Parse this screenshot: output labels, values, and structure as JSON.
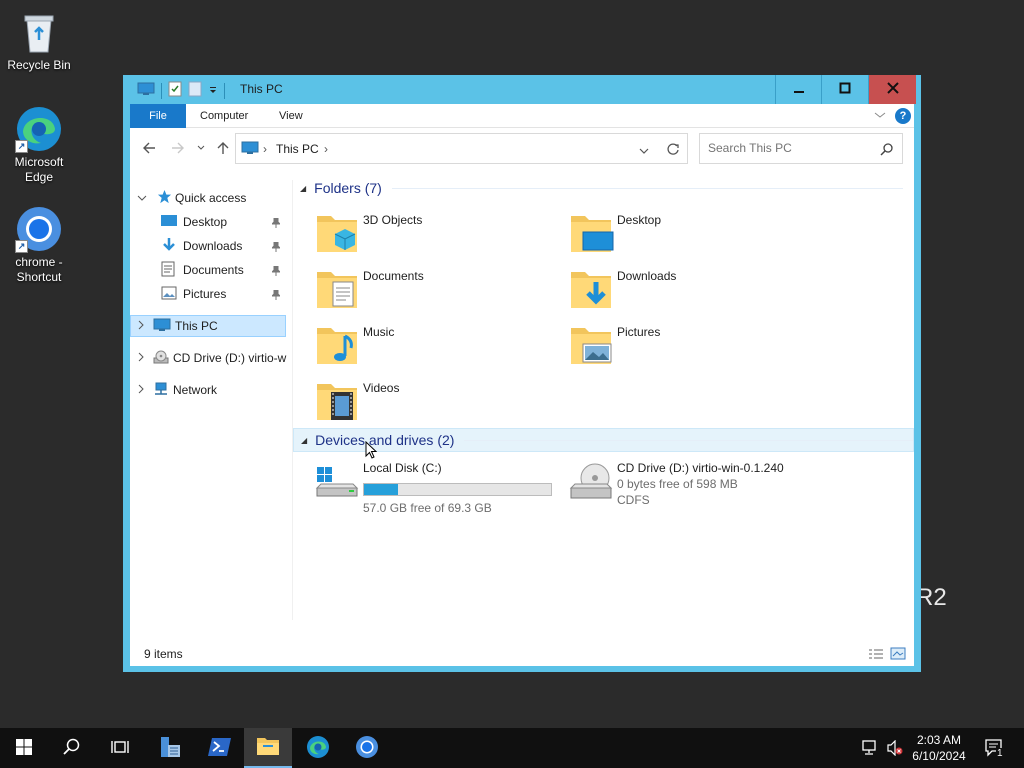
{
  "desktop": {
    "icons": [
      {
        "label": "Recycle Bin"
      },
      {
        "label": "Microsoft Edge"
      },
      {
        "label": "chrome - Shortcut"
      }
    ],
    "watermark": "R2"
  },
  "window": {
    "title": "This PC",
    "ribbon_tabs": [
      "File",
      "Computer",
      "View"
    ],
    "help_label": "?",
    "address": "This PC",
    "search_placeholder": "Search This PC"
  },
  "sidebar": {
    "items": [
      {
        "label": "Quick access",
        "icon": "star-icon"
      },
      {
        "label": "Desktop",
        "icon": "desktop-folder-icon",
        "pinned": true
      },
      {
        "label": "Downloads",
        "icon": "downloads-icon",
        "pinned": true
      },
      {
        "label": "Documents",
        "icon": "documents-icon",
        "pinned": true
      },
      {
        "label": "Pictures",
        "icon": "pictures-icon",
        "pinned": true
      },
      {
        "label": "This PC",
        "icon": "computer-icon",
        "selected": true
      },
      {
        "label": "CD Drive (D:) virtio-w",
        "icon": "cd-drive-icon"
      },
      {
        "label": "Network",
        "icon": "network-icon"
      }
    ]
  },
  "folders": {
    "header": "Folders (7)",
    "items": [
      {
        "name": "3D Objects",
        "icon": "3d-objects-folder-icon"
      },
      {
        "name": "Desktop",
        "icon": "desktop-folder-icon"
      },
      {
        "name": "Documents",
        "icon": "documents-folder-icon"
      },
      {
        "name": "Downloads",
        "icon": "downloads-folder-icon"
      },
      {
        "name": "Music",
        "icon": "music-folder-icon"
      },
      {
        "name": "Pictures",
        "icon": "pictures-folder-icon"
      },
      {
        "name": "Videos",
        "icon": "videos-folder-icon"
      }
    ]
  },
  "devices": {
    "header": "Devices and drives (2)",
    "items": [
      {
        "name": "Local Disk (C:)",
        "free_text": "57.0 GB free of 69.3 GB",
        "used_fraction": 0.18,
        "icon": "local-disk-icon"
      },
      {
        "name": "CD Drive (D:) virtio-win-0.1.240",
        "free_text": "0 bytes free of 598 MB",
        "fs": "CDFS",
        "icon": "cd-drive-icon"
      }
    ]
  },
  "status": {
    "items_count": "9 items"
  },
  "taskbar": {
    "time": "2:03 AM",
    "date": "6/10/2024",
    "notification_count": "1",
    "colors": {
      "background": "#101010",
      "accent": "#76b9ed"
    }
  },
  "colors": {
    "title_bar": "#5bc2e7",
    "file_tab": "#1979ca",
    "close_button": "#c75050",
    "selection": "#cce8ff"
  }
}
